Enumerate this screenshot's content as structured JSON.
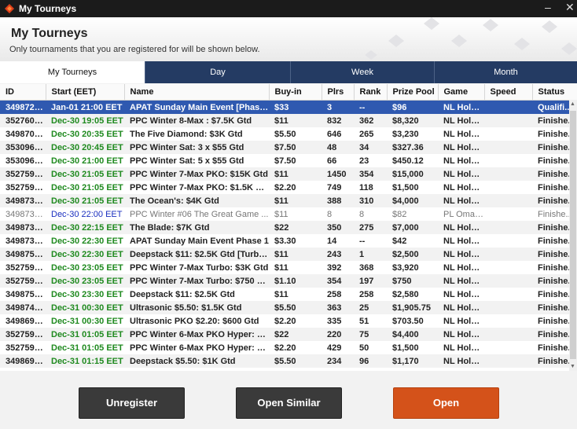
{
  "window": {
    "title": "My Tourneys"
  },
  "header": {
    "title": "My Tourneys",
    "subtitle": "Only tournaments that you are registered for will be shown below."
  },
  "tabs": [
    {
      "label": "My Tourneys",
      "active": true
    },
    {
      "label": "Day"
    },
    {
      "label": "Week"
    },
    {
      "label": "Month"
    }
  ],
  "table": {
    "columns": [
      "ID",
      "Start (EET)",
      "Name",
      "Buy-in",
      "Plrs",
      "Rank",
      "Prize Pool",
      "Game",
      "Speed",
      "Status"
    ],
    "rows": [
      [
        "3498725...",
        "Jan-01 21:00 EET",
        "APAT Sunday Main Event [Phase ...",
        "$33",
        "3",
        "--",
        "$96",
        "NL Hold'...",
        "",
        "Qualifi..."
      ],
      [
        "3527600...",
        "Dec-30 19:05 EET",
        "PPC Winter 8-Max : $7.5K Gtd",
        "$11",
        "832",
        "362",
        "$8,320",
        "NL Hold'...",
        "",
        "Finishe..."
      ],
      [
        "3498704...",
        "Dec-30 20:35 EET",
        "The Five Diamond: $3K Gtd",
        "$5.50",
        "646",
        "265",
        "$3,230",
        "NL Hold'...",
        "",
        "Finishe..."
      ],
      [
        "3530965...",
        "Dec-30 20:45 EET",
        "PPC Winter Sat: 3 x $55 Gtd",
        "$7.50",
        "48",
        "34",
        "$327.36",
        "NL Hold'...",
        "",
        "Finishe..."
      ],
      [
        "3530964...",
        "Dec-30 21:00 EET",
        "PPC Winter Sat: 5 x $55 Gtd",
        "$7.50",
        "66",
        "23",
        "$450.12",
        "NL Hold'...",
        "",
        "Finishe..."
      ],
      [
        "3527597...",
        "Dec-30 21:05 EET",
        "PPC Winter 7-Max PKO: $15K Gtd",
        "$11",
        "1450",
        "354",
        "$15,000",
        "NL Hold'...",
        "",
        "Finishe..."
      ],
      [
        "3527597...",
        "Dec-30 21:05 EET",
        "PPC Winter 7-Max PKO: $1.5K Gtd",
        "$2.20",
        "749",
        "118",
        "$1,500",
        "NL Hold'...",
        "",
        "Finishe..."
      ],
      [
        "3498731...",
        "Dec-30 21:05 EET",
        "The Ocean's: $4K Gtd",
        "$11",
        "388",
        "310",
        "$4,000",
        "NL Hold'...",
        "",
        "Finishe..."
      ],
      [
        "3498739...",
        "Dec-30 22:00 EET",
        "PPC Winter #06 The Great Game ...",
        "$11",
        "8",
        "8",
        "$82",
        "PL Omah...",
        "",
        "Finishe..."
      ],
      [
        "3498730...",
        "Dec-30 22:15 EET",
        "The Blade: $7K Gtd",
        "$22",
        "350",
        "275",
        "$7,000",
        "NL Hold'...",
        "",
        "Finishe..."
      ],
      [
        "3498738...",
        "Dec-30 22:30 EET",
        "APAT Sunday Main Event Phase 1",
        "$3.30",
        "14",
        "--",
        "$42",
        "NL Hold'...",
        "",
        "Finishe..."
      ],
      [
        "3498758...",
        "Dec-30 22:30 EET",
        "Deepstack $11: $2.5K Gtd [Turbo, ...",
        "$11",
        "243",
        "1",
        "$2,500",
        "NL Hold'...",
        "",
        "Finishe..."
      ],
      [
        "3527599...",
        "Dec-30 23:05 EET",
        "PPC Winter 7-Max Turbo: $3K Gtd",
        "$11",
        "392",
        "368",
        "$3,920",
        "NL Hold'...",
        "",
        "Finishe..."
      ],
      [
        "3527599...",
        "Dec-30 23:05 EET",
        "PPC Winter 7-Max Turbo: $750 Gtd",
        "$1.10",
        "354",
        "197",
        "$750",
        "NL Hold'...",
        "",
        "Finishe..."
      ],
      [
        "3498753...",
        "Dec-30 23:30 EET",
        "Deepstack $11: $2.5K Gtd",
        "$11",
        "258",
        "258",
        "$2,580",
        "NL Hold'...",
        "",
        "Finishe..."
      ],
      [
        "3498748...",
        "Dec-31 00:30 EET",
        "Ultrasonic $5.50: $1.5K Gtd",
        "$5.50",
        "363",
        "25",
        "$1,905.75",
        "NL Hold'...",
        "",
        "Finishe..."
      ],
      [
        "3498697...",
        "Dec-31 00:30 EET",
        "Ultrasonic PKO $2.20: $600 Gtd",
        "$2.20",
        "335",
        "51",
        "$703.50",
        "NL Hold'...",
        "",
        "Finishe..."
      ],
      [
        "3527598...",
        "Dec-31 01:05 EET",
        "PPC Winter 6-Max PKO Hyper: $3...",
        "$22",
        "220",
        "75",
        "$4,400",
        "NL Hold'...",
        "",
        "Finishe..."
      ],
      [
        "3527598...",
        "Dec-31 01:05 EET",
        "PPC Winter 6-Max PKO Hyper: $1...",
        "$2.20",
        "429",
        "50",
        "$1,500",
        "NL Hold'...",
        "",
        "Finishe..."
      ],
      [
        "3498698...",
        "Dec-31 01:15 EET",
        "Deepstack $5.50: $1K Gtd",
        "$5.50",
        "234",
        "96",
        "$1,170",
        "NL Hold'...",
        "",
        "Finishe..."
      ]
    ],
    "selected_row": 0,
    "muted_rows": [
      8
    ]
  },
  "buttons": {
    "unregister": "Unregister",
    "open_similar": "Open Similar",
    "open": "Open"
  },
  "colors": {
    "accent": "#d4521a",
    "selection": "#2f59b0",
    "tab_bar": "#243b63",
    "start_green": "#1f8a1f",
    "start_blue": "#1a2fbf"
  },
  "icons": [
    "app-logo-icon",
    "minimize-icon",
    "close-icon",
    "scroll-up-icon",
    "scroll-down-icon"
  ]
}
